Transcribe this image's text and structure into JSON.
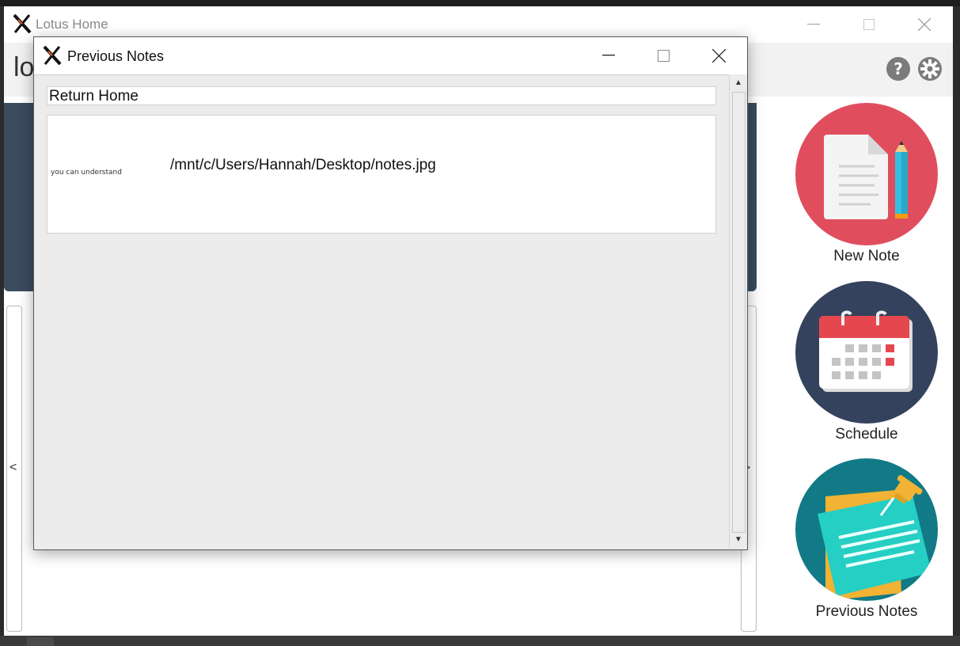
{
  "main_window": {
    "title": "Lotus Home",
    "app_name": "lo",
    "help_label": "?"
  },
  "side_buttons": [
    {
      "label": "New Note"
    },
    {
      "label": "Schedule"
    },
    {
      "label": "Previous Notes"
    }
  ],
  "carousel": {
    "prev_label": "<",
    "next_label": ">"
  },
  "dialog": {
    "title": "Previous Notes",
    "return_label": "Return Home",
    "notes": [
      {
        "thumbnail_text": "you can understand",
        "path": "/mnt/c/Users/Hannah/Desktop/notes.jpg"
      }
    ]
  },
  "colors": {
    "banner": "#3b4c5e",
    "new_note": "#e04e5e",
    "schedule": "#34425d",
    "previous_notes": "#117a86"
  }
}
